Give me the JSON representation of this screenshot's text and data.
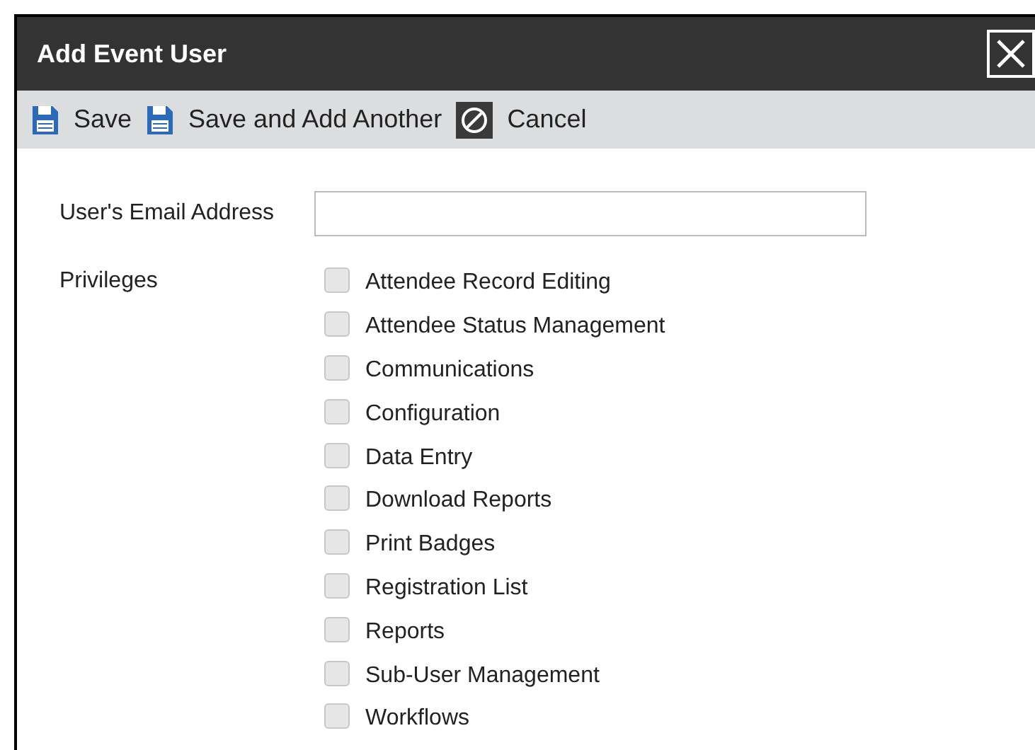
{
  "window": {
    "title": "Add Event User"
  },
  "toolbar": [
    {
      "kind": "save",
      "label": "Save"
    },
    {
      "kind": "save",
      "label": "Save and Add Another"
    },
    {
      "kind": "cancel",
      "label": "Cancel"
    }
  ],
  "email": {
    "label": "User's Email Address"
  },
  "privileges": {
    "label": "Privileges",
    "items": [
      {
        "label": "Attendee Record Editing",
        "checked": false
      },
      {
        "label": "Attendee Status Management",
        "checked": false
      },
      {
        "label": "Communications",
        "checked": false
      },
      {
        "label": "Configuration",
        "checked": false
      },
      {
        "label": "Data Entry",
        "checked": false
      },
      {
        "label": "Download Reports",
        "checked": false
      },
      {
        "label": "Print Badges",
        "checked": false
      },
      {
        "label": "Registration List",
        "checked": false
      },
      {
        "label": "Reports",
        "checked": false
      },
      {
        "label": "Sub-User Management",
        "checked": false
      },
      {
        "label": "Workflows",
        "checked": false
      }
    ]
  }
}
